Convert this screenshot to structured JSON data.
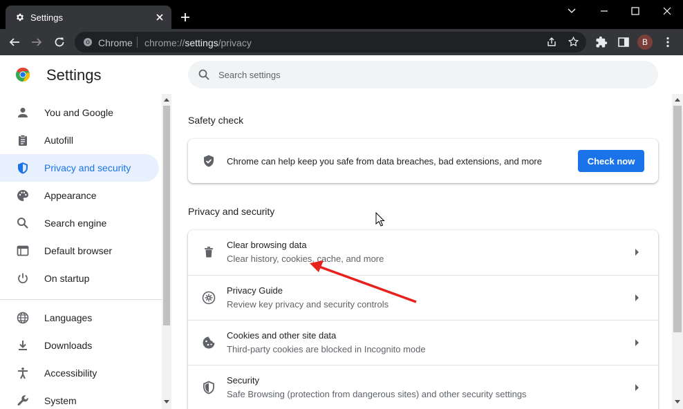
{
  "tab": {
    "title": "Settings"
  },
  "omnibox": {
    "chip": "Chrome",
    "url_scheme": "chrome://",
    "url_host": "settings",
    "url_path": "/privacy"
  },
  "profile": {
    "initial": "B"
  },
  "header": {
    "title": "Settings"
  },
  "search": {
    "placeholder": "Search settings"
  },
  "sidebar": {
    "items": [
      {
        "label": "You and Google",
        "icon": "person-icon"
      },
      {
        "label": "Autofill",
        "icon": "clipboard-icon"
      },
      {
        "label": "Privacy and security",
        "icon": "shield-icon",
        "active": true
      },
      {
        "label": "Appearance",
        "icon": "palette-icon"
      },
      {
        "label": "Search engine",
        "icon": "search-icon"
      },
      {
        "label": "Default browser",
        "icon": "browser-window-icon"
      },
      {
        "label": "On startup",
        "icon": "power-icon"
      },
      {
        "label": "Languages",
        "icon": "globe-icon"
      },
      {
        "label": "Downloads",
        "icon": "download-icon"
      },
      {
        "label": "Accessibility",
        "icon": "accessibility-icon"
      },
      {
        "label": "System",
        "icon": "wrench-icon"
      }
    ]
  },
  "safety_check": {
    "title": "Safety check",
    "description": "Chrome can help keep you safe from data breaches, bad extensions, and more",
    "button": "Check now"
  },
  "privacy": {
    "title": "Privacy and security",
    "rows": [
      {
        "title": "Clear browsing data",
        "subtitle": "Clear history, cookies, cache, and more",
        "icon": "trash-icon"
      },
      {
        "title": "Privacy Guide",
        "subtitle": "Review key privacy and security controls",
        "icon": "compass-icon"
      },
      {
        "title": "Cookies and other site data",
        "subtitle": "Third-party cookies are blocked in Incognito mode",
        "icon": "cookie-icon"
      },
      {
        "title": "Security",
        "subtitle": "Safe Browsing (protection from dangerous sites) and other security settings",
        "icon": "security-shield-icon"
      }
    ]
  },
  "colors": {
    "accent": "#1a73e8",
    "active_bg": "#e8f0fe",
    "annotation_arrow": "#e8211c",
    "chrome_dark": "#35363a"
  }
}
